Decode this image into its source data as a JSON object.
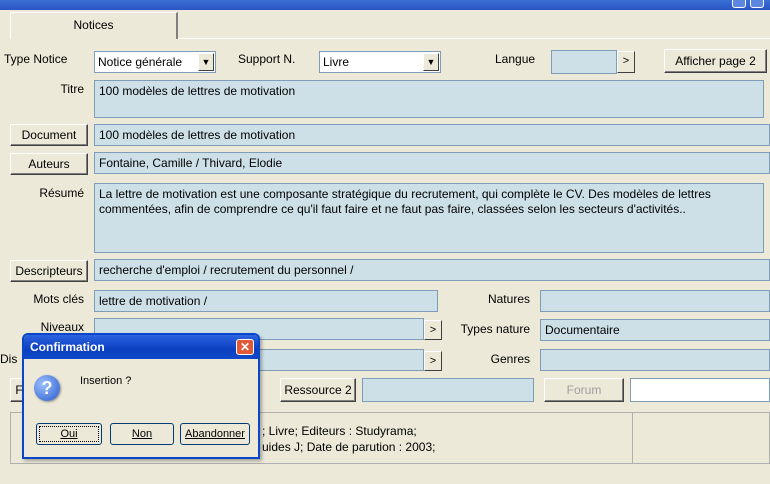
{
  "tabs": [
    {
      "label": "Notices"
    }
  ],
  "row1": {
    "type_label": "Type Notice",
    "type_value": "Notice générale",
    "support_label": "Support N.",
    "support_value": "Livre",
    "langue_label": "Langue",
    "langue_button": ">",
    "afficher_label": "Afficher page 2"
  },
  "titre": {
    "label": "Titre",
    "value": "100 modèles de lettres de motivation"
  },
  "document": {
    "label": "Document",
    "value": "100 modèles de lettres de motivation"
  },
  "auteurs": {
    "label": "Auteurs",
    "value": "Fontaine, Camille / Thivard, Elodie"
  },
  "resume": {
    "label": "Résumé",
    "value": "La lettre de motivation est une composante stratégique du recrutement, qui complète le CV. Des modèles de lettres commentées, afin de comprendre ce qu'il faut faire et ne faut pas faire, classées selon les secteurs d'activités.."
  },
  "descripteurs": {
    "label": "Descripteurs",
    "value": "recherche d'emploi  / recrutement du personnel  /"
  },
  "mots_cles": {
    "label": "Mots clés",
    "value": "lettre de motivation /"
  },
  "natures": {
    "label": "Natures",
    "value": ""
  },
  "niveaux": {
    "label": "Niveaux",
    "button": ">"
  },
  "types_nature": {
    "label": "Types nature",
    "value": "Documentaire"
  },
  "disciplines": {
    "label_partial": "Dis",
    "button": ">"
  },
  "genres": {
    "label": "Genres",
    "value": ""
  },
  "row_resources": {
    "left_partial": "F",
    "ressource2_label": "Ressource 2",
    "forum_label": "Forum"
  },
  "bottom_text": {
    "line1": "; Livre;  Editeurs : Studyrama;",
    "line2": "uides J;  Date de parution : 2003;"
  },
  "dialog": {
    "title": "Confirmation",
    "close": "✕",
    "icon": "?",
    "message": "Insertion ?",
    "buttons": {
      "yes": "Oui",
      "no": "Non",
      "cancel": "Abandonner"
    }
  },
  "colors": {
    "titlebar": "#2a55c4",
    "field_blue": "#cde0e8",
    "panel": "#ece9d8"
  }
}
